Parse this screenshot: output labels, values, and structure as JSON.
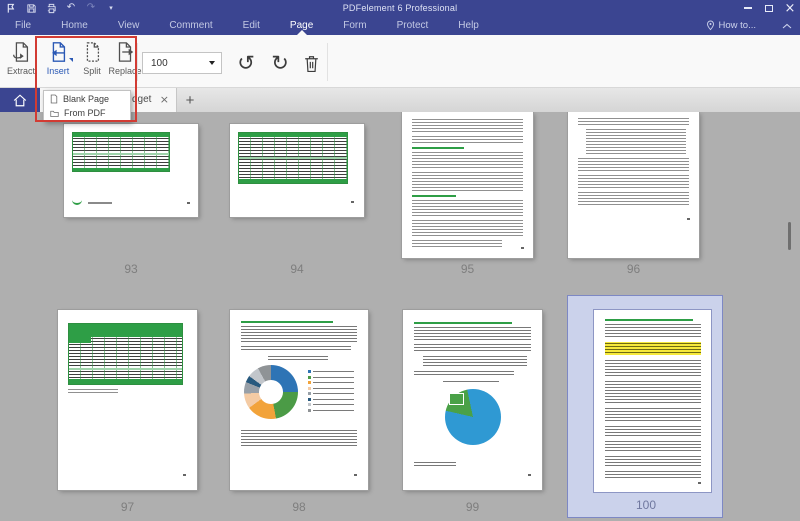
{
  "window": {
    "title": "PDFelement 6 Professional"
  },
  "menubar": {
    "items": [
      "File",
      "Home",
      "View",
      "Comment",
      "Edit",
      "Page",
      "Form",
      "Protect",
      "Help"
    ],
    "active_item": "Page",
    "how_to": "How to..."
  },
  "ribbon": {
    "extract_label": "Extract",
    "insert_label": "Insert",
    "split_label": "Split",
    "replace_label": "Replace",
    "page_number_value": "100"
  },
  "insert_dropdown": {
    "blank_page_label": "Blank Page",
    "from_pdf_label": "From PDF"
  },
  "tabbar": {
    "active_tab_text": "dget"
  },
  "pages": [
    {
      "number": "93",
      "kind": "landscape-green-table",
      "selected": false
    },
    {
      "number": "94",
      "kind": "landscape-green-table",
      "selected": false
    },
    {
      "number": "95",
      "kind": "text-page",
      "selected": false
    },
    {
      "number": "96",
      "kind": "text-page-with-bullets",
      "selected": false
    },
    {
      "number": "97",
      "kind": "green-table-page",
      "selected": false
    },
    {
      "number": "98",
      "kind": "donut-chart-page",
      "selected": false
    },
    {
      "number": "99",
      "kind": "pie-chart-page",
      "selected": false
    },
    {
      "number": "100",
      "kind": "text-page-yellow-highlight",
      "selected": true
    }
  ],
  "colors": {
    "titlebar": "#3b4591",
    "annotation_red": "#d23b33",
    "selection_fill": "#cbd2eb",
    "selection_border": "#7d88c4",
    "document_green": "#2e9e46",
    "highlight_yellow": "#f6e93b",
    "donut": [
      "#2e74b5",
      "#4b9b46",
      "#f2a33a",
      "#f4cba4",
      "#98a0a8",
      "#27597e",
      "#c2c6cb",
      "#8f9396"
    ],
    "pie": [
      "#2f99d3",
      "#4aa147"
    ]
  }
}
